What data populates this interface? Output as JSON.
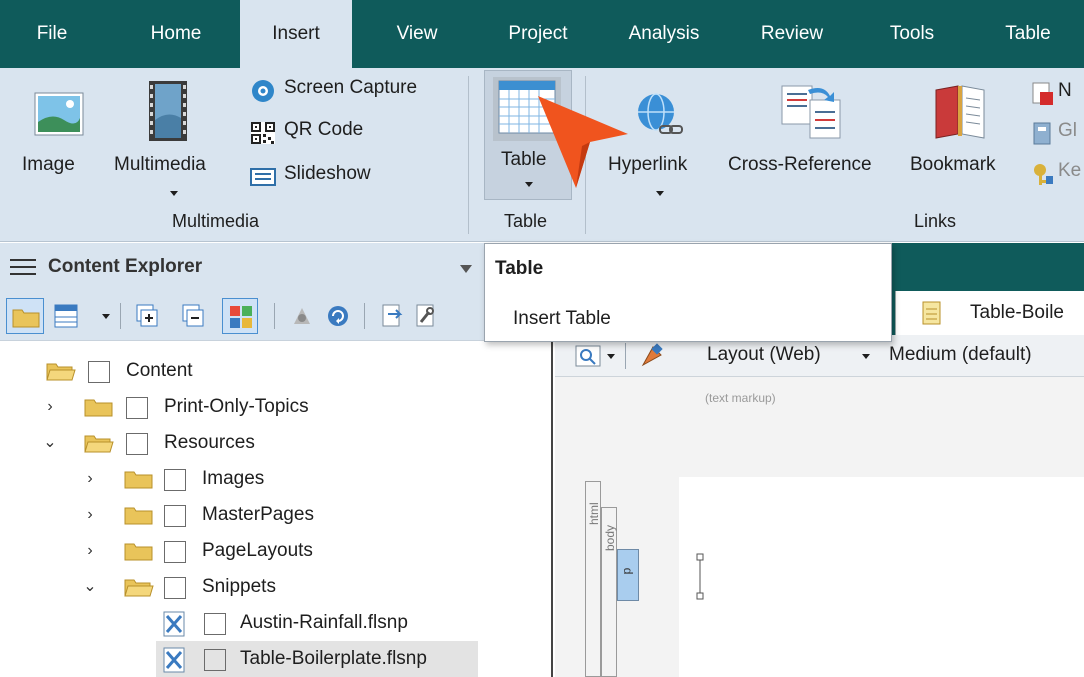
{
  "menubar": {
    "tabs": [
      {
        "label": "File"
      },
      {
        "label": "Home"
      },
      {
        "label": "Insert",
        "active": true
      },
      {
        "label": "View"
      },
      {
        "label": "Project"
      },
      {
        "label": "Analysis"
      },
      {
        "label": "Review"
      },
      {
        "label": "Tools"
      },
      {
        "label": "Table"
      }
    ]
  },
  "ribbon": {
    "multimedia": {
      "image_label": "Image",
      "multimedia_label": "Multimedia",
      "screen_capture_label": "Screen Capture",
      "qr_code_label": "QR Code",
      "slideshow_label": "Slideshow",
      "group_label": "Multimedia"
    },
    "table": {
      "table_label": "Table",
      "group_label": "Table"
    },
    "links": {
      "hyperlink_label": "Hyperlink",
      "cross_reference_label": "Cross-Reference",
      "bookmark_label": "Bookmark",
      "cut_off_1": "N",
      "cut_off_2": "Gl",
      "cut_off_3": "Ke",
      "group_label": "Links"
    }
  },
  "dropdown": {
    "title": "Table",
    "item": "Insert Table"
  },
  "content_explorer": {
    "title": "Content Explorer",
    "tree": [
      {
        "label": "Content"
      },
      {
        "label": "Print-Only-Topics"
      },
      {
        "label": "Resources"
      },
      {
        "label": "Images"
      },
      {
        "label": "MasterPages"
      },
      {
        "label": "PageLayouts"
      },
      {
        "label": "Snippets"
      },
      {
        "label": "Austin-Rainfall.flsnp"
      },
      {
        "label": "Table-Boilerplate.flsnp"
      }
    ]
  },
  "editor": {
    "doc_tab_label": "Table-Boile",
    "layout_label": "Layout (Web)",
    "medium_label": "Medium (default)",
    "markup_hint": "(text markup)",
    "struct_html": "html",
    "struct_body": "body",
    "struct_p": "p"
  },
  "colors": {
    "menubar": "#0f5b5b",
    "ribbon": "#d9e4ef",
    "pointer": "#f0541e"
  }
}
